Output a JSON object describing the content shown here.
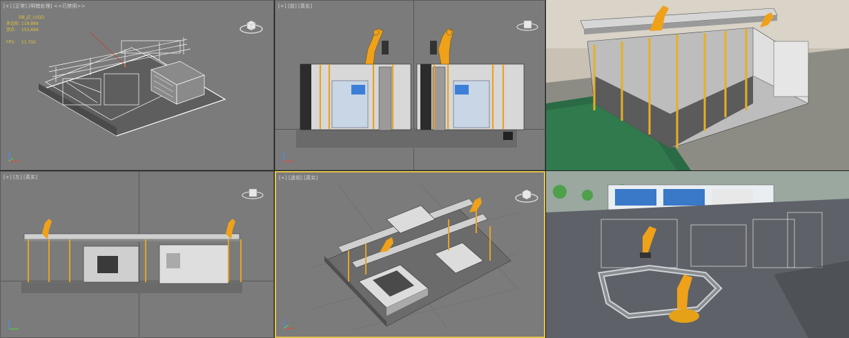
{
  "viewports": {
    "perspective_tl": {
      "labels": [
        "[+]",
        "[正常]",
        "[明暗处理]",
        "<<已禁用>>"
      ],
      "stats": {
        "name": "DB_JZ_LSQD",
        "polys_label": "多边形:",
        "polys_value": "119,889",
        "verts_label": "顶点:",
        "verts_value": "153,666",
        "fps_label": "FPS:",
        "fps_value": "11.702"
      }
    },
    "front": {
      "labels": [
        "[+]",
        "[前]",
        "[真实]"
      ]
    },
    "left": {
      "labels": [
        "[+]",
        "[左]",
        "[真实]"
      ]
    },
    "perspective_br": {
      "labels": [
        "[+]",
        "[透视]",
        "[真实]"
      ]
    }
  },
  "icons": [
    "viewcube-icon",
    "axis-gizmo-icon",
    "robot-arm-icon",
    "gantry-icon",
    "cnc-machine-icon",
    "conveyor-icon"
  ],
  "colors": {
    "viewport_bg": "#7b7b7b",
    "active_border": "#e6c34a",
    "robot": "#f0a11a",
    "stats_text": "#e1c63c",
    "label_text": "#d9d9d9"
  }
}
